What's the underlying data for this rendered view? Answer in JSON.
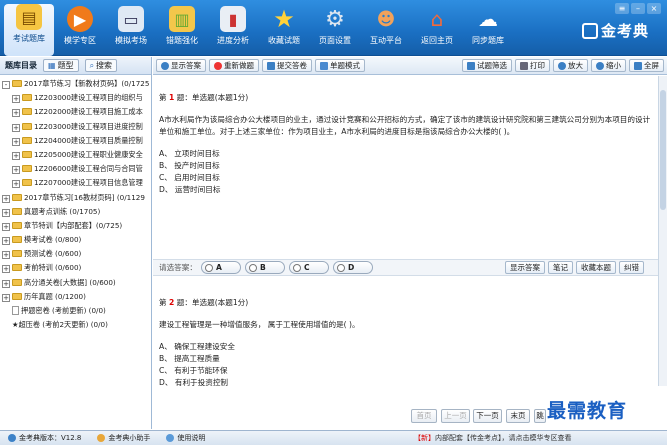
{
  "nav": [
    {
      "label": "考试题库",
      "icon": "book-icon",
      "active": true
    },
    {
      "label": "模拟考场",
      "icon": "play-icon"
    },
    {
      "label": "模拟考场",
      "icon": "monitor-icon"
    },
    {
      "label": "错题强化",
      "icon": "bars-icon"
    },
    {
      "label": "进度分析",
      "icon": "chart-icon"
    },
    {
      "label": "收藏试题",
      "icon": "star-icon"
    },
    {
      "label": "页面设置",
      "icon": "gear-icon"
    },
    {
      "label": "互动平台",
      "icon": "people-icon"
    },
    {
      "label": "返回主页",
      "icon": "home-icon"
    },
    {
      "label": "同步题库",
      "icon": "cloud-icon"
    }
  ],
  "nav_labels_fix": {
    "item2": "模学专区"
  },
  "logo": "金考典",
  "left": {
    "title": "题库目录",
    "btn_type": "题型",
    "btn_search": "搜索",
    "tree": [
      {
        "level": 1,
        "kind": "folder",
        "exp": "-",
        "text": "2017章节练习【新教材页码】(0/1725"
      },
      {
        "level": 2,
        "kind": "folder",
        "exp": "+",
        "text": "1Z203000建设工程项目的组织与"
      },
      {
        "level": 2,
        "kind": "folder",
        "exp": "+",
        "text": "1Z202000建设工程项目施工成本"
      },
      {
        "level": 2,
        "kind": "folder",
        "exp": "+",
        "text": "1Z203000建设工程项目进度控制"
      },
      {
        "level": 2,
        "kind": "folder",
        "exp": "+",
        "text": "1Z204000建设工程项目质量控制"
      },
      {
        "level": 2,
        "kind": "folder",
        "exp": "+",
        "text": "1Z205000建设工程职业健康安全"
      },
      {
        "level": 2,
        "kind": "folder",
        "exp": "+",
        "text": "1Z206000建设工程合同与合同管"
      },
      {
        "level": 2,
        "kind": "folder",
        "exp": "+",
        "text": "1Z207000建设工程项目信息管理"
      },
      {
        "level": 1,
        "kind": "folder",
        "exp": "+",
        "text": "2017章节练习[16教材页码] (0/1129"
      },
      {
        "level": 1,
        "kind": "folder",
        "exp": "+",
        "text": "真题考点训练 (0/1705)"
      },
      {
        "level": 1,
        "kind": "folder",
        "exp": "+",
        "text": "章节特训【内部配套】(0/725)"
      },
      {
        "level": 1,
        "kind": "folder",
        "exp": "+",
        "text": "模考试卷 (0/800)"
      },
      {
        "level": 1,
        "kind": "folder",
        "exp": "+",
        "text": "预测试卷 (0/600)"
      },
      {
        "level": 1,
        "kind": "folder",
        "exp": "+",
        "text": "考前特训 (0/600)"
      },
      {
        "level": 1,
        "kind": "folder",
        "exp": "+",
        "text": "高分通关卷[大数据] (0/600)"
      },
      {
        "level": 1,
        "kind": "folder",
        "exp": "+",
        "text": "历年真题 (0/1200)"
      },
      {
        "level": 1,
        "kind": "doc",
        "exp": "",
        "text": "押题密卷 (考前更新) (0/0)"
      },
      {
        "level": 1,
        "kind": "star",
        "exp": "",
        "text": "★超压卷 (考前2天更新) (0/0)"
      }
    ]
  },
  "toolbar": {
    "show_answer": "显示答案",
    "redo": "重新做题",
    "submit": "提交答卷",
    "single_mode": "单题模式",
    "filter": "试题筛选",
    "print": "打印",
    "zoom_in": "放大",
    "zoom_out": "缩小",
    "fullscreen": "全屏"
  },
  "q1": {
    "head_prefix": "第",
    "num": "1",
    "head_suffix": "题：单选题(本题1分)",
    "text": "A市水利局作为该局综合办公大楼项目的业主，通过设计竞赛和公开招标的方式，确定了该市的建筑设计研究院和第三建筑公司分别为本项目的设计单位和施工单位。对于上述三家单位：作为项目业主，A市水利局的进度目标是指该局综合办公大楼的( )。",
    "options": [
      "A、 立项时间目标",
      "B、 投产时间目标",
      "C、 启用时间目标",
      "D、 运营时间目标"
    ]
  },
  "answer_bar": {
    "label": "请选答案：",
    "choices": [
      "A",
      "B",
      "C",
      "D"
    ],
    "show": "显示答案",
    "note": "笔记",
    "fav": "收藏本题",
    "err": "纠错"
  },
  "q2": {
    "head_prefix": "第",
    "num": "2",
    "head_suffix": "题：单选题(本题1分)",
    "text": "建设工程管理是一种增值服务， 属于工程使用增值的是( )。",
    "options": [
      "A、 确保工程建设安全",
      "B、 提高工程质量",
      "C、 有利于节能环保",
      "D、 有利于投资控制"
    ]
  },
  "pager": {
    "first": "首页",
    "prev": "上一页",
    "next": "下一页",
    "last": "末页",
    "jump": "跳"
  },
  "watermark": "最需教育",
  "status": {
    "version": "金考典版本：V12.8",
    "helper": "金考典小助手",
    "guide": "使用说明",
    "news_tag": "【新】",
    "news_text": "内部配套【传金考点】，请点击模华专区查看"
  },
  "colors": {
    "accent": "#1a6fc2",
    "question_num": "#dd0000"
  }
}
